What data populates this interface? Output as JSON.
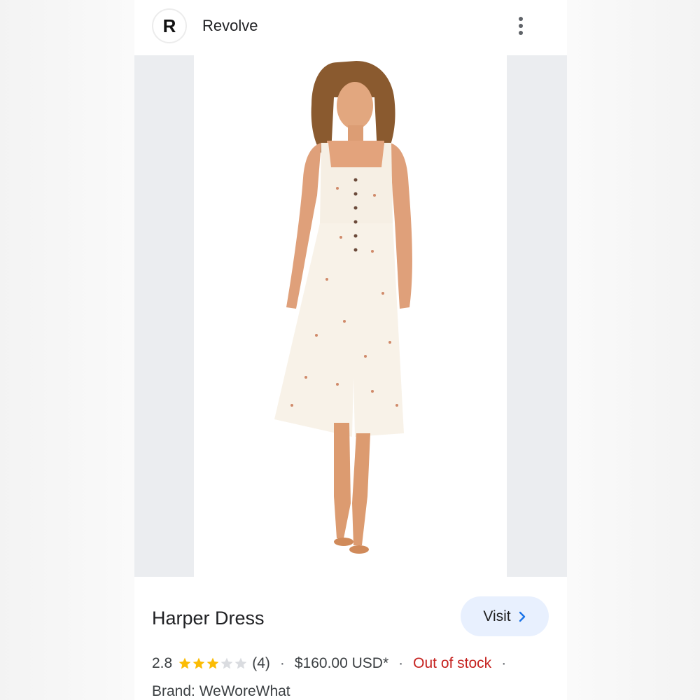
{
  "header": {
    "avatar_letter": "R",
    "site_name": "Revolve",
    "more_icon": "more-vert-icon"
  },
  "product": {
    "title": "Harper Dress",
    "visit_label": "Visit",
    "rating": "2.8",
    "stars_filled": 3,
    "stars_total": 5,
    "review_count": "(4)",
    "price": "$160.00 USD*",
    "stock_status": "Out of stock",
    "brand": "Brand: WeWoreWhat",
    "separator": "·"
  },
  "colors": {
    "star_filled": "#fbbc04",
    "star_empty": "#dadce0",
    "out_of_stock": "#c5221f",
    "visit_bg": "#e8f0fe",
    "chevron": "#1a73e8"
  }
}
